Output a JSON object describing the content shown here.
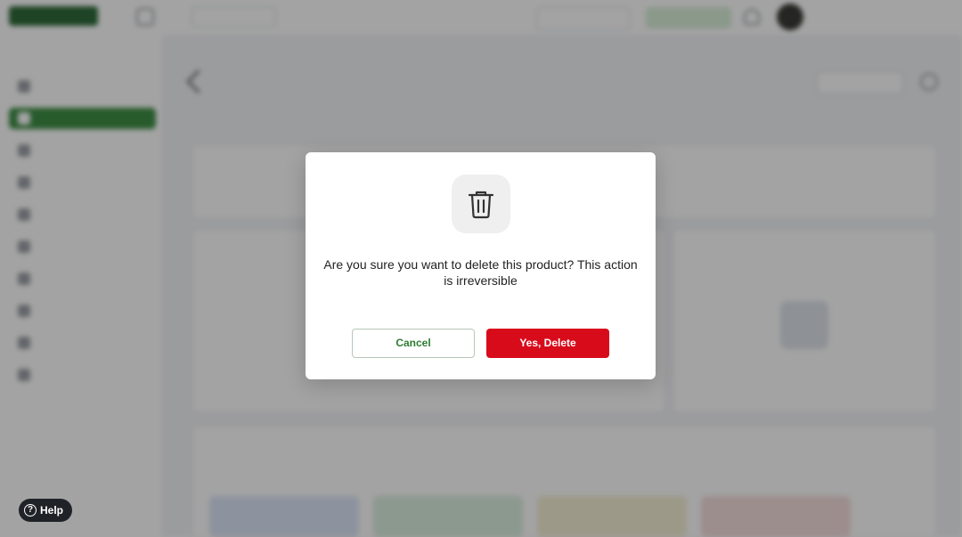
{
  "modal": {
    "message": "Are you sure you want to delete this product? This action is irreversible",
    "cancel_label": "Cancel",
    "confirm_label": "Yes, Delete",
    "icon": "trash-icon",
    "colors": {
      "confirm_bg": "#d80b1b",
      "cancel_text": "#2e7d32"
    }
  },
  "help": {
    "label": "Help",
    "icon": "question-circle-icon"
  },
  "background": {
    "brand_color": "#2f6b3a",
    "active_nav_color": "#3f8f46"
  }
}
